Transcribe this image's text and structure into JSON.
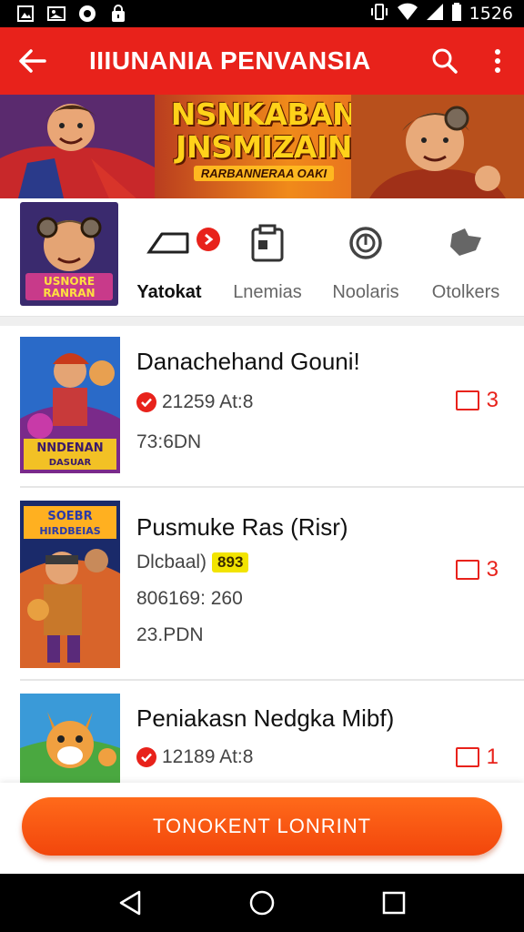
{
  "status_bar": {
    "time": "1526"
  },
  "app_bar": {
    "title": "IIIUNANIA PENVANSIA"
  },
  "banner": {
    "title_line1": "NSNKABAN",
    "title_line2": "JNSMIZAIN",
    "subtitle": "RARBANNERAA OAKI"
  },
  "tab_thumb": {
    "line1": "USNORE",
    "line2": "RANRAN"
  },
  "tabs": [
    {
      "label": "Yatokat",
      "active": true
    },
    {
      "label": "Lnemias",
      "active": false
    },
    {
      "label": "Noolaris",
      "active": false
    },
    {
      "label": "Otolkers",
      "active": false
    }
  ],
  "items": [
    {
      "title": "Danachehand Gouni!",
      "meta1": "21259 At:8",
      "meta2": "73:6DN",
      "count": "3",
      "thumb_label1": "NNDENAN",
      "thumb_label2": "DASUAR"
    },
    {
      "title": "Pusmuke Ras (Risr)",
      "meta1_prefix": "Dlcbaal)",
      "tag": "893",
      "meta1": "806169: 260",
      "meta2": "23.PDN",
      "count": "3",
      "thumb_label1": "SOEBR",
      "thumb_label2": "HIRDBEIAS"
    },
    {
      "title": "Peniakasn Nedgka Mibf)",
      "meta1": "12189 At:8",
      "count": "1"
    }
  ],
  "action_button": {
    "label": "TONOKENT LONRINT"
  },
  "colors": {
    "accent": "#e8221b",
    "button": "#f2460c"
  }
}
